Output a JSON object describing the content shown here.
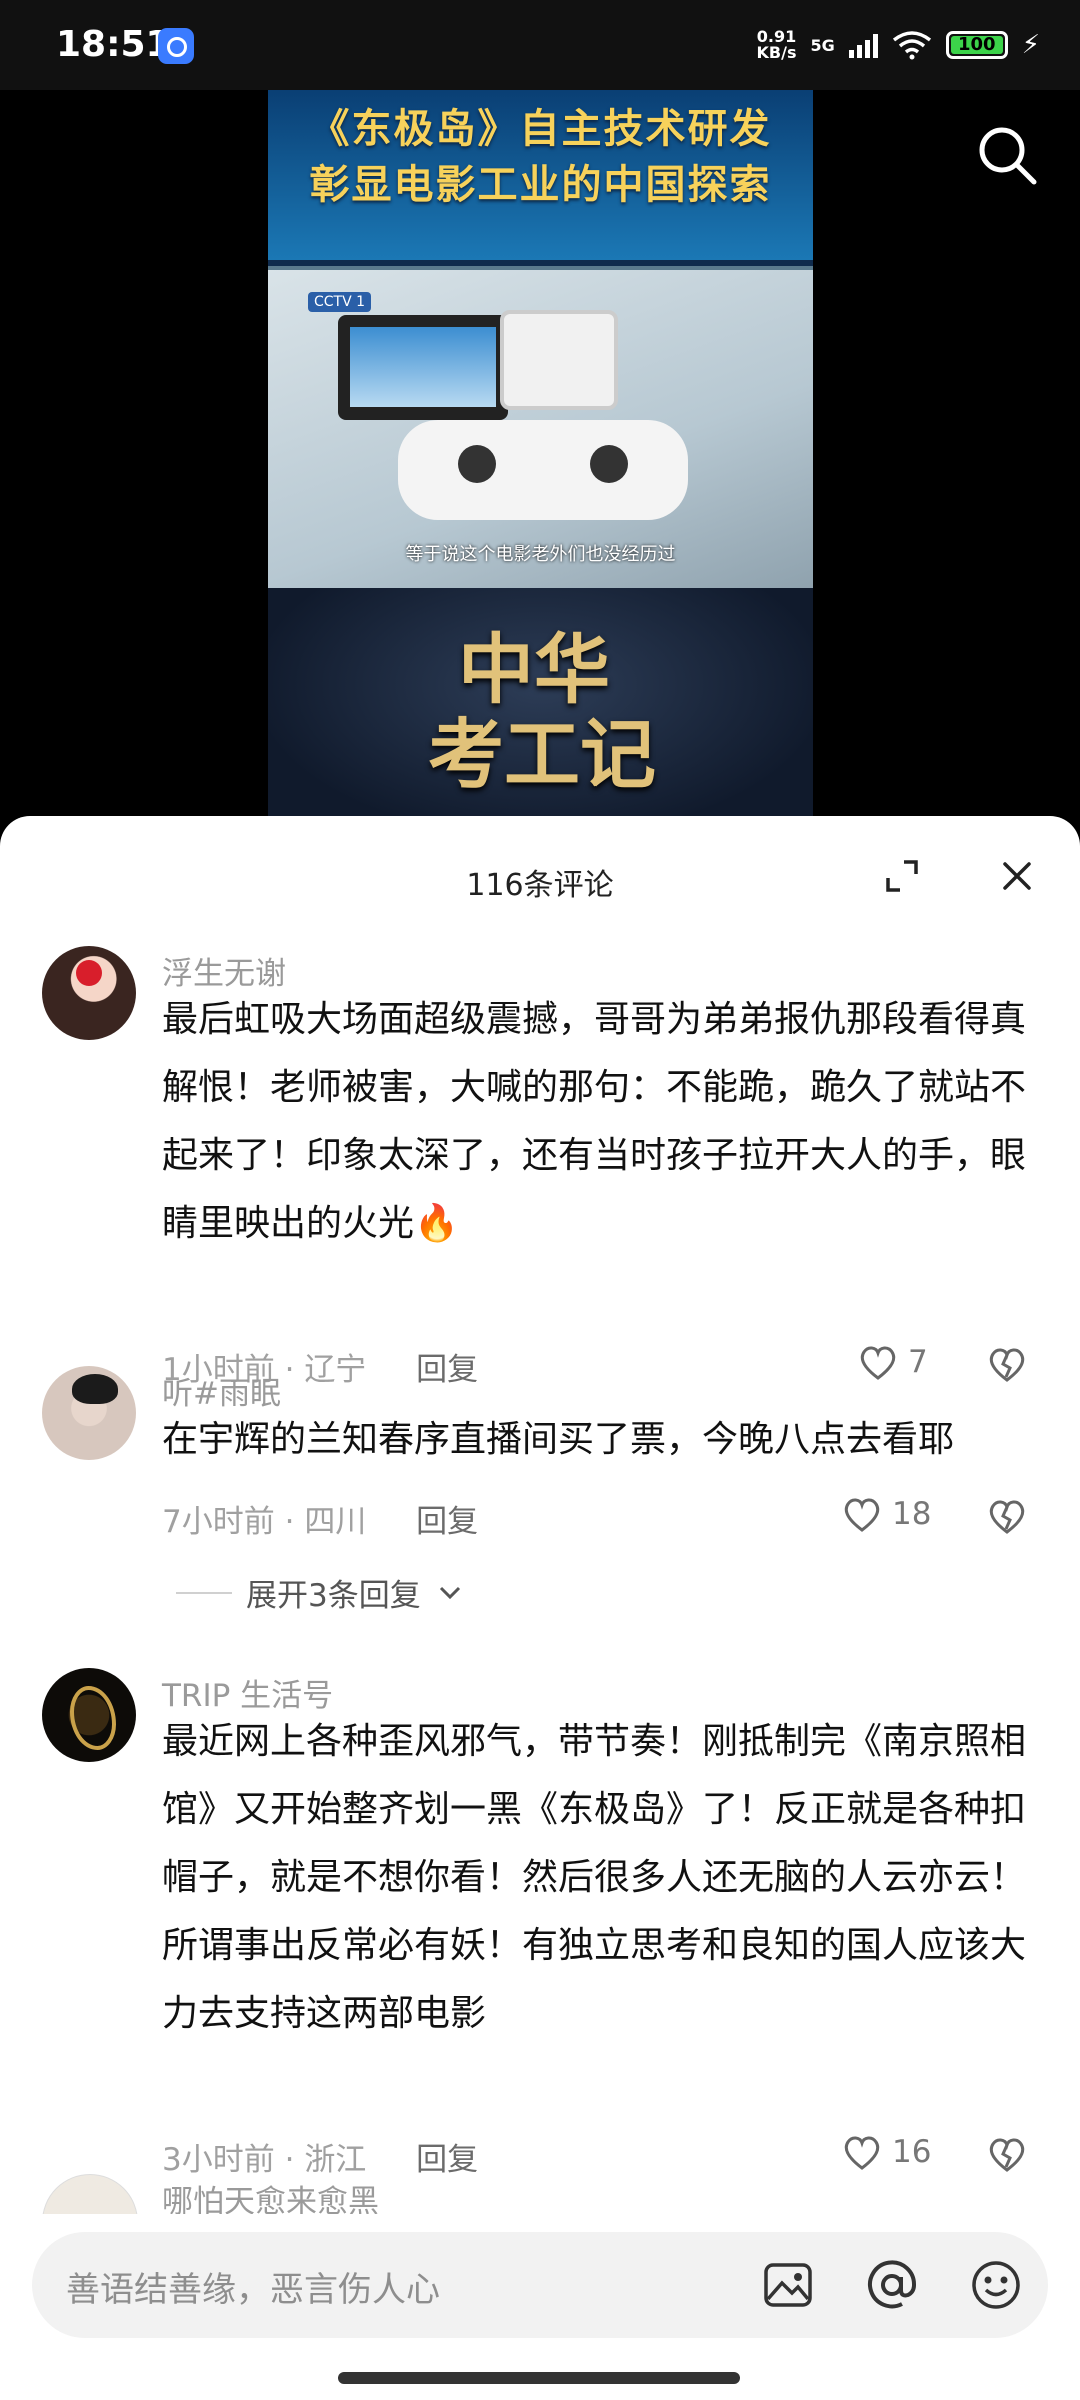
{
  "status_bar": {
    "time": "18:51",
    "net_speed_value": "0.91",
    "net_speed_unit": "KB/s",
    "network": "5G",
    "battery": "100"
  },
  "video": {
    "title_line1": "《东极岛》自主技术研发",
    "title_line2": "彰显电影工业的中国探索",
    "subtitle": "等于说这个电影老外们也没经历过",
    "cctv_logo": "CCTV 1",
    "big_title_1": "中华",
    "big_title_2": "考工记"
  },
  "sheet": {
    "comment_count": "116条评论"
  },
  "comments": [
    {
      "user": "浮生无谢",
      "text": "最后虹吸大场面超级震撼，哥哥为弟弟报仇那段看得真解恨！老师被害，大喊的那句：不能跪，跪久了就站不起来了！印象太深了，还有当时孩子拉开大人的手，眼睛里映出的火光🔥",
      "time": "1小时前",
      "location": "辽宁",
      "reply": "回复",
      "likes": "7"
    },
    {
      "user": "听#雨眠",
      "text": "在宇辉的兰知春序直播间买了票，今晚八点去看耶",
      "time": "7小时前",
      "location": "四川",
      "reply": "回复",
      "likes": "18",
      "expand_replies": "展开3条回复"
    },
    {
      "user": "TRIP 生活号",
      "text": "最近网上各种歪风邪气，带节奏！刚抵制完《南京照相馆》又开始整齐划一黑《东极岛》了！反正就是各种扣帽子，就是不想你看！然后很多人还无脑的人云亦云！所谓事出反常必有妖！有独立思考和良知的国人应该大力去支持这两部电影",
      "time": "3小时前",
      "location": "浙江",
      "reply": "回复",
      "likes": "16"
    },
    {
      "user": "哪怕天愈来愈黑"
    }
  ],
  "input": {
    "placeholder": "善语结善缘，恶言伤人心"
  }
}
